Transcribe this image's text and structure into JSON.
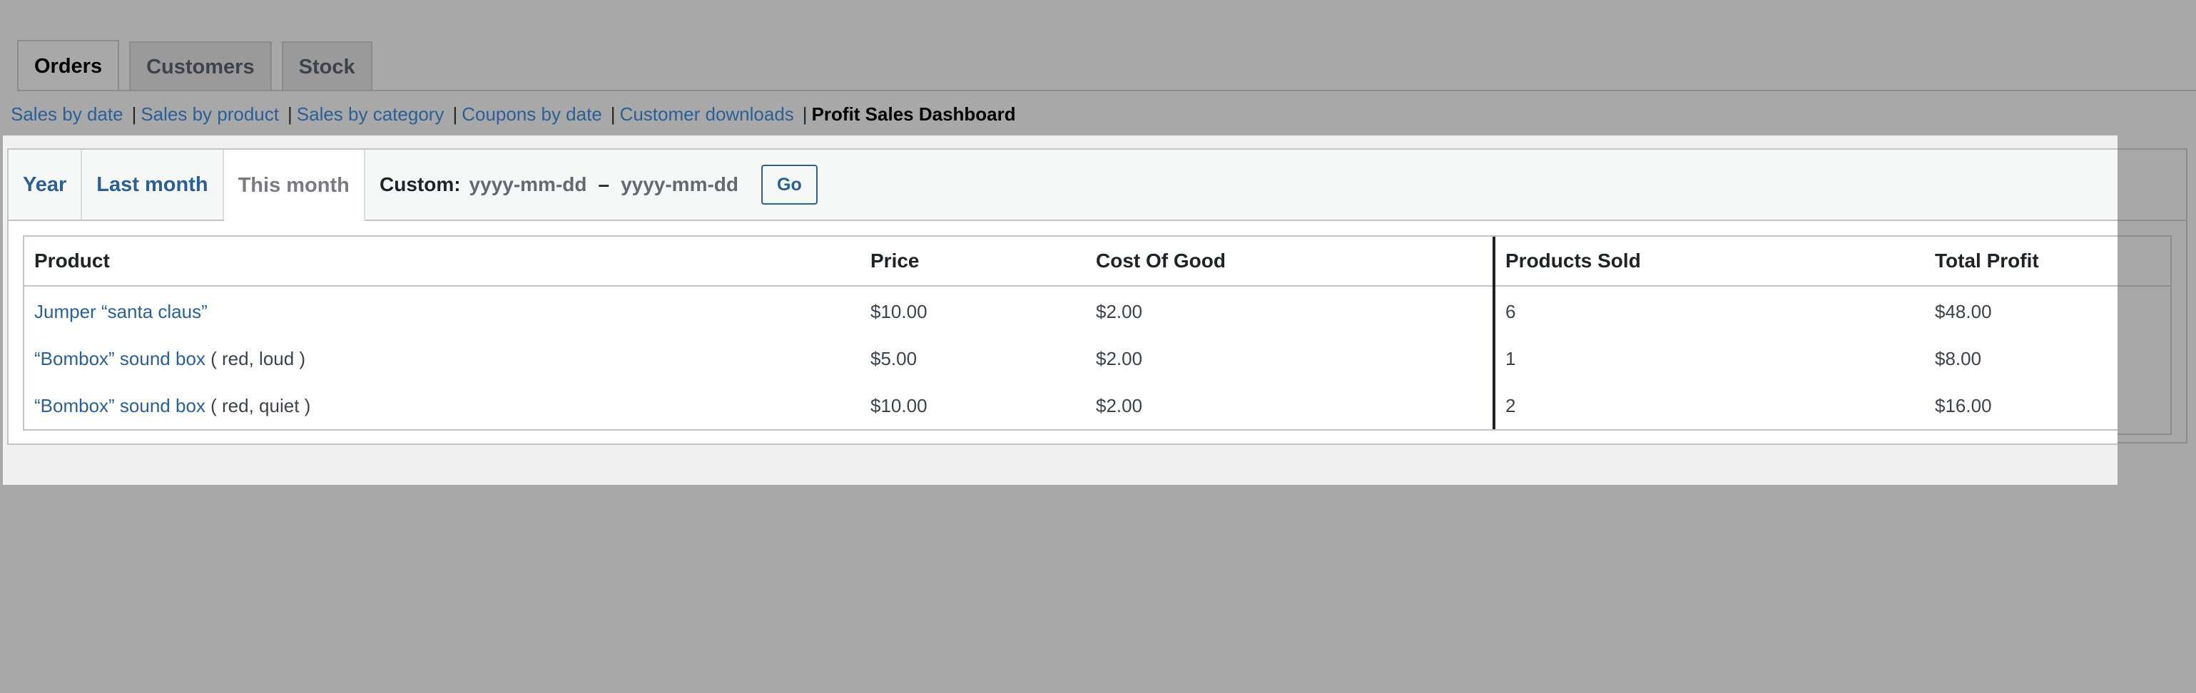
{
  "nav_tabs": [
    {
      "label": "Orders",
      "active": true
    },
    {
      "label": "Customers",
      "active": false
    },
    {
      "label": "Stock",
      "active": false
    }
  ],
  "sub_links": [
    {
      "label": "Sales by date",
      "current": false
    },
    {
      "label": "Sales by product",
      "current": false
    },
    {
      "label": "Sales by category",
      "current": false
    },
    {
      "label": "Coupons by date",
      "current": false
    },
    {
      "label": "Customer downloads",
      "current": false
    },
    {
      "label": "Profit Sales Dashboard",
      "current": true
    }
  ],
  "separator": "|",
  "range_tabs": [
    {
      "label": "Year",
      "active": false
    },
    {
      "label": "Last month",
      "active": false
    },
    {
      "label": "This month",
      "active": true
    }
  ],
  "custom": {
    "label": "Custom:",
    "start_placeholder": "yyyy-mm-dd",
    "dash": "–",
    "end_placeholder": "yyyy-mm-dd",
    "go_label": "Go"
  },
  "table": {
    "headers": [
      "Product",
      "Price",
      "Cost Of Good",
      "Products Sold",
      "Total Profit"
    ],
    "rows": [
      {
        "product": "Jumper “santa claus”",
        "attrs": "",
        "price": "$10.00",
        "cost": "$2.00",
        "sold": "6",
        "profit": "$48.00"
      },
      {
        "product": "“Bombox” sound box",
        "attrs": " ( red, loud )",
        "price": "$5.00",
        "cost": "$2.00",
        "sold": "1",
        "profit": "$8.00"
      },
      {
        "product": "“Bombox” sound box",
        "attrs": " ( red, quiet )",
        "price": "$10.00",
        "cost": "$2.00",
        "sold": "2",
        "profit": "$16.00"
      }
    ]
  },
  "colors": {
    "link": "#2b5f96",
    "overlay": "#a8a8a8",
    "spotlight": "#f0f0f0"
  }
}
